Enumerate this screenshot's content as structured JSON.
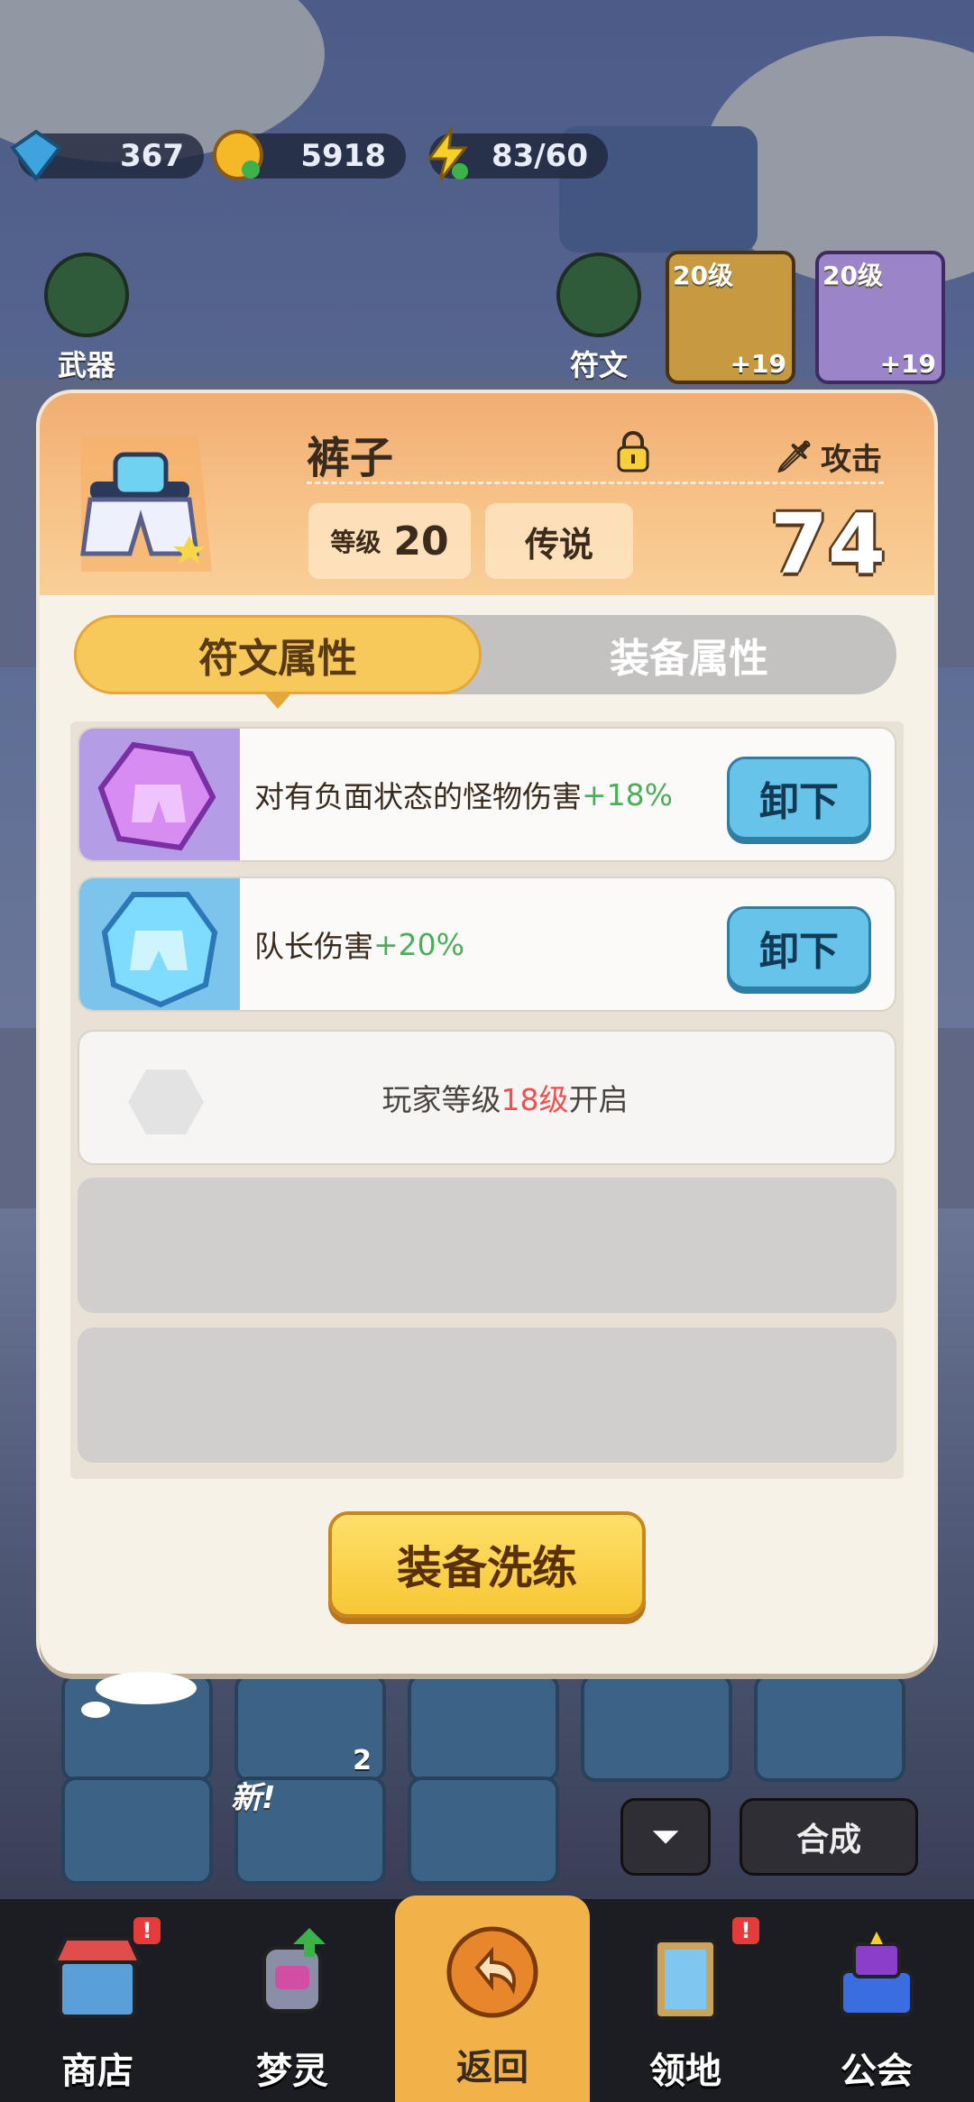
{
  "resources": [
    {
      "icon": "diamond-icon",
      "value": "367"
    },
    {
      "icon": "coin-icon",
      "value": "5918"
    },
    {
      "icon": "energy-icon",
      "value": "83/60"
    }
  ],
  "background": {
    "weapon_label": "武器",
    "rune_label": "符文",
    "gear_cards": [
      {
        "level": "20级",
        "plus": "+19"
      },
      {
        "level": "20级",
        "plus": "+19"
      }
    ],
    "slot_count": "2",
    "new_tag": "新!",
    "compose_label": "合成"
  },
  "item": {
    "name": "裤子",
    "stat_type": "攻击",
    "level_label": "等级",
    "level_value": "20",
    "rarity": "传说",
    "power": "74"
  },
  "tabs": [
    {
      "label": "符文属性",
      "active": true
    },
    {
      "label": "装备属性",
      "active": false
    }
  ],
  "runes": [
    {
      "color": "purple",
      "text": "对有负面状态的怪物伤害",
      "bonus": "+18%",
      "button": "卸下"
    },
    {
      "color": "blue",
      "text": "队长伤害",
      "bonus": "+20%",
      "button": "卸下"
    }
  ],
  "locked_slot": {
    "prefix": "玩家等级",
    "level": "18级",
    "suffix": "开启"
  },
  "refine_button": "装备洗练",
  "nav": [
    {
      "label": "商店",
      "icon": "shop-icon",
      "badge": "!"
    },
    {
      "label": "梦灵",
      "icon": "spirit-icon"
    },
    {
      "label": "返回",
      "icon": "back-arrow-icon",
      "active": true
    },
    {
      "label": "领地",
      "icon": "territory-icon",
      "badge": "!"
    },
    {
      "label": "公会",
      "icon": "guild-icon"
    }
  ],
  "colors": {
    "accent": "#f7c95a",
    "bonus_green": "#4cae5a",
    "unlock_red": "#ee5151",
    "unload_blue": "#66c3ea"
  }
}
